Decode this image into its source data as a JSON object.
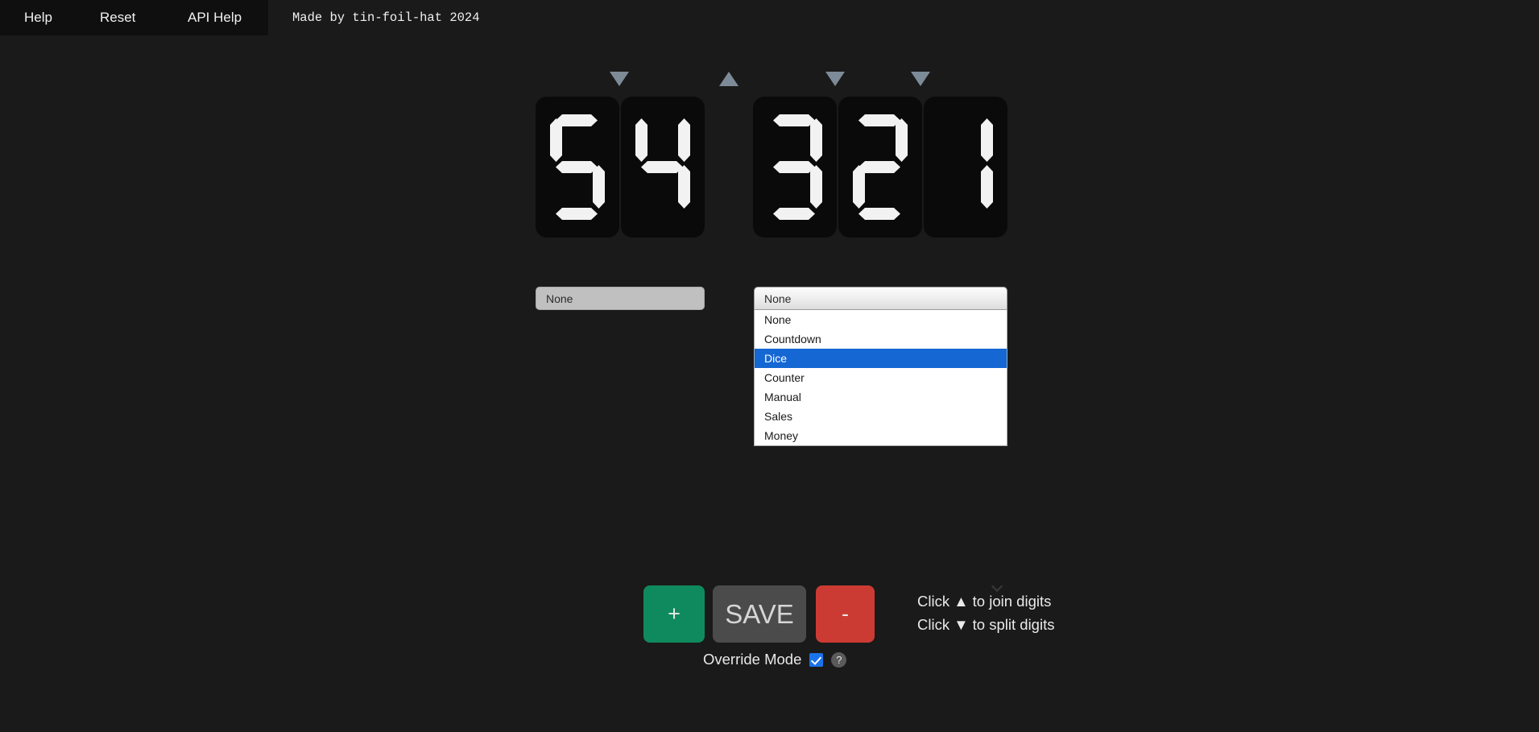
{
  "navbar": {
    "links": [
      {
        "label": "Help"
      },
      {
        "label": "Reset"
      },
      {
        "label": "API Help"
      }
    ],
    "credit": "Made by tin-foil-hat 2024"
  },
  "display": {
    "groups": [
      {
        "digits": [
          "5",
          "4"
        ]
      },
      {
        "digits": [
          "3",
          "2",
          "1"
        ]
      }
    ],
    "arrows": [
      {
        "direction": "down",
        "icon": "triangle-down-icon"
      },
      {
        "direction": "up",
        "icon": "triangle-up-icon"
      },
      {
        "direction": "down",
        "icon": "triangle-down-icon"
      },
      {
        "direction": "down",
        "icon": "triangle-down-icon"
      }
    ],
    "arrow_color": "#7d8b99",
    "segment_color": "#f2f2f2",
    "panel_color": "#0a0a0a"
  },
  "selects": {
    "left": {
      "value": "None"
    },
    "right": {
      "value": "None",
      "open": true
    },
    "options": [
      "None",
      "Countdown",
      "Dice",
      "Counter",
      "Manual",
      "Sales",
      "Money"
    ],
    "highlighted_option": "Dice",
    "highlight_color": "#1567d3"
  },
  "controls": {
    "plus_label": "+",
    "save_label": "SAVE",
    "minus_label": "-",
    "plus_color": "#0f8a5f",
    "save_color": "#4b4b4b",
    "minus_color": "#cc3b33"
  },
  "hints": {
    "line1": "Click ▲ to join digits",
    "line2": "Click ▼ to split digits"
  },
  "override": {
    "label": "Override Mode",
    "checked": true,
    "help_label": "?"
  }
}
